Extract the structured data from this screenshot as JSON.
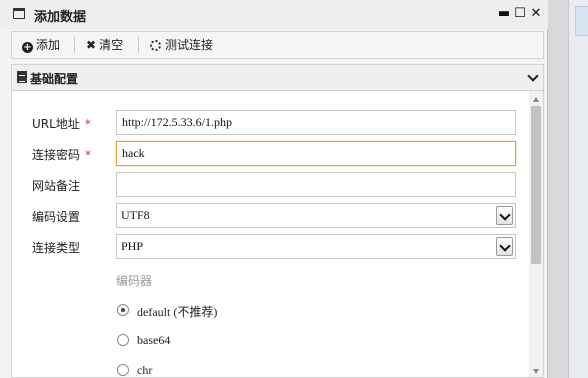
{
  "window": {
    "title": "添加数据"
  },
  "toolbar": {
    "add_label": "添加",
    "clear_label": "清空",
    "test_label": "测试连接"
  },
  "section": {
    "title": "基础配置"
  },
  "form": {
    "url": {
      "label": "URL地址",
      "required_mark": "*",
      "value": "http://172.5.33.6/1.php"
    },
    "password": {
      "label": "连接密码",
      "required_mark": "*",
      "value": "hack"
    },
    "note": {
      "label": "网站备注",
      "value": ""
    },
    "encoding": {
      "label": "编码设置",
      "value": "UTF8"
    },
    "conn_type": {
      "label": "连接类型",
      "value": "PHP"
    },
    "encoder": {
      "label": "编码器",
      "options": [
        {
          "label": "default (不推荐)",
          "checked": true
        },
        {
          "label": "base64",
          "checked": false
        },
        {
          "label": "chr",
          "checked": false
        }
      ]
    }
  }
}
